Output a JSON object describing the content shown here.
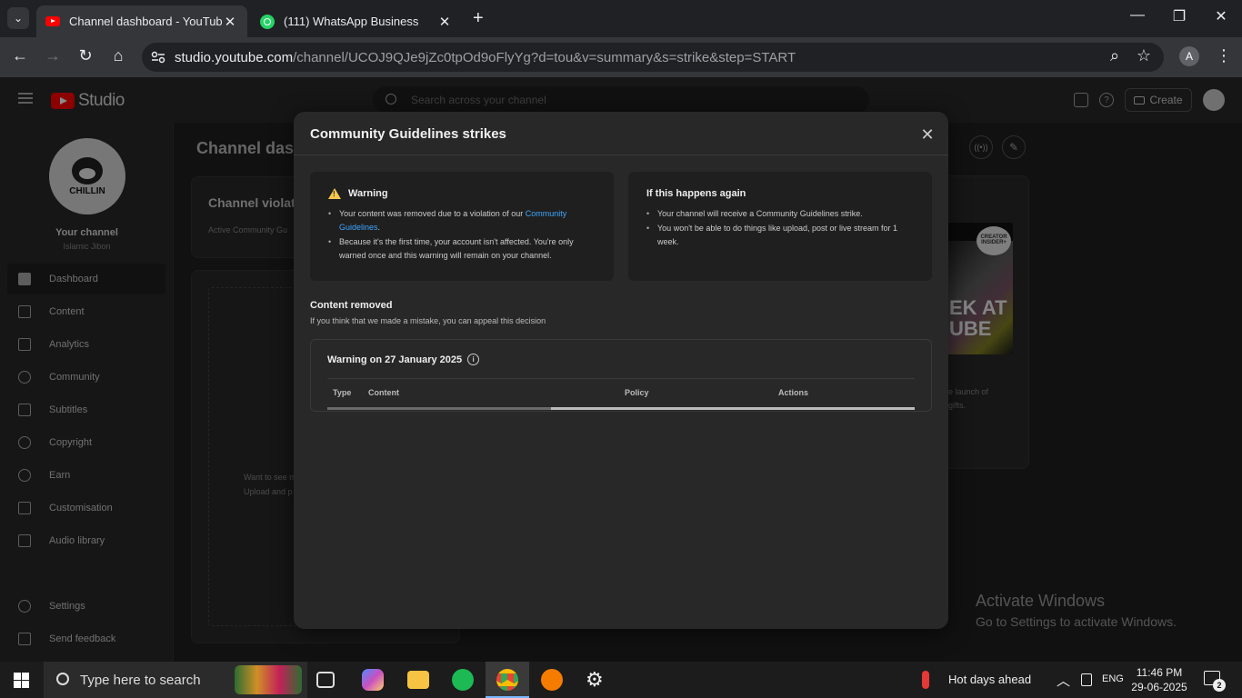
{
  "browser": {
    "tabs": [
      {
        "title": "Channel dashboard - YouTube S",
        "icon": "youtube-icon",
        "active": true
      },
      {
        "title": "(111) WhatsApp Business",
        "icon": "whatsapp-icon",
        "active": false
      }
    ],
    "url_host": "studio.youtube.com",
    "url_path": "/channel/UCOJ9QJe9jZc0tpOd9oFlyYg?d=tou&v=summary&s=strike&step=START",
    "profile_initial": "A"
  },
  "studio": {
    "logo_text": "Studio",
    "search_placeholder": "Search across your channel",
    "create_label": "Create"
  },
  "sidebar": {
    "channel_title": "Your channel",
    "channel_name": "Islamic Jibon",
    "avatar_text": "CHILLIN",
    "items": [
      {
        "label": "Dashboard",
        "icon": "dashboard-icon"
      },
      {
        "label": "Content",
        "icon": "content-icon"
      },
      {
        "label": "Analytics",
        "icon": "analytics-icon"
      },
      {
        "label": "Community",
        "icon": "community-icon"
      },
      {
        "label": "Subtitles",
        "icon": "subtitles-icon"
      },
      {
        "label": "Copyright",
        "icon": "copyright-icon"
      },
      {
        "label": "Earn",
        "icon": "earn-icon"
      },
      {
        "label": "Customisation",
        "icon": "customisation-icon"
      },
      {
        "label": "Audio library",
        "icon": "audio-library-icon"
      }
    ],
    "settings_label": "Settings",
    "feedback_label": "Send feedback"
  },
  "background": {
    "dash_title": "Channel dash",
    "violation_title": "Channel violatio",
    "violation_sub": "Active Community Gu",
    "upload_text_1": "Want to see m",
    "upload_text_2": "Upload and p",
    "thumb_badge": "CREATOR INSIDER+",
    "thumb_big": "EK AT UBE",
    "news_text_1": "e launch of",
    "news_text_2": "gifts."
  },
  "dialog": {
    "title": "Community Guidelines strikes",
    "warning": {
      "heading": "Warning",
      "bullet1_pre": "Your content was removed due to a violation of our ",
      "bullet1_link": "Community Guidelines",
      "bullet1_post": ".",
      "bullet2": "Because it's the first time, your account isn't affected. You're only warned once and this warning will remain on your channel."
    },
    "again": {
      "heading": "If this happens again",
      "bullet1": "Your channel will receive a Community Guidelines strike.",
      "bullet2": "You won't be able to do things like upload, post or live stream for 1 week."
    },
    "content_removed_title": "Content removed",
    "content_removed_sub": "If you think that we made a mistake, you can appeal this decision",
    "warning_date": "Warning on 27 January 2025",
    "columns": [
      "Type",
      "Content",
      "Policy",
      "Actions"
    ]
  },
  "watermark": {
    "line1": "Activate Windows",
    "line2": "Go to Settings to activate Windows."
  },
  "taskbar": {
    "search_placeholder": "Type here to search",
    "weather": "Hot days ahead",
    "lang": "ENG",
    "time": "11:46 PM",
    "date": "29-06-2025",
    "notif_count": "2"
  }
}
